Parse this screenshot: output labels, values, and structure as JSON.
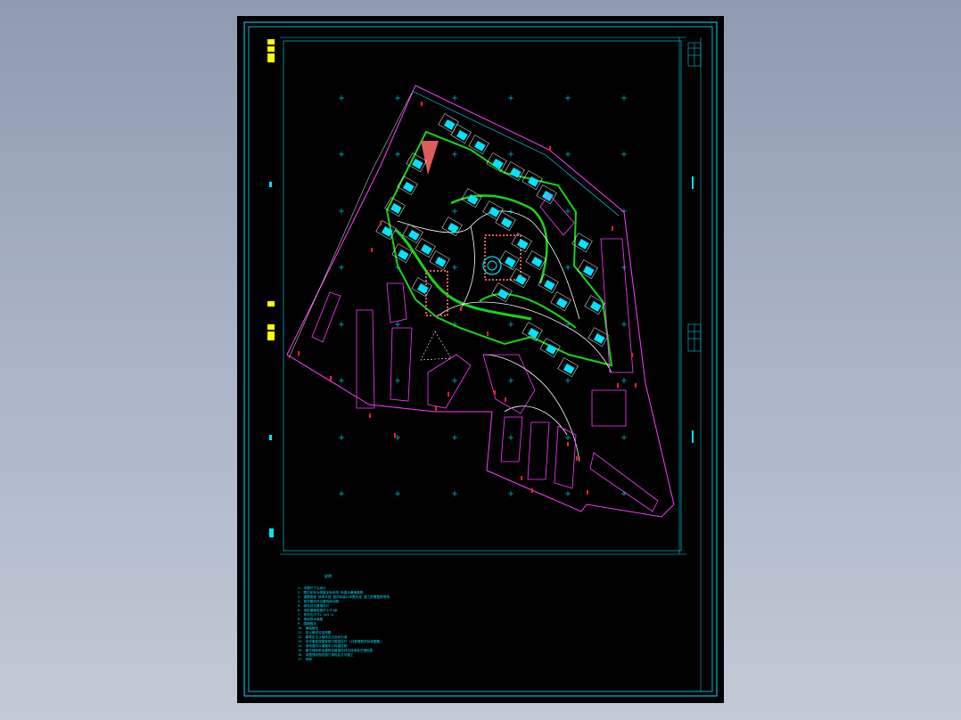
{
  "viewer": {
    "background_top": "#8e9bb0",
    "background_bottom": "#c3cad6",
    "sheet_color": "#000000"
  },
  "drawing": {
    "type": "CAD site plan",
    "colors": {
      "frame": "#00e5ff",
      "grid_cross": "#00e5ff",
      "boundary": "#ff3cff",
      "road": "#ffffff",
      "green": "#19d419",
      "yellow_text": "#ffff00",
      "plaza": "#e05c5c",
      "red_marks": "#ff2020"
    },
    "notes_title": "说明",
    "notes_lines": [
      "1. 本图尺寸以米计",
      "2. 图中坐标为测量坐标系统 标高为黄海高程",
      "3. 道路宽度 转弯半径 竖向标高以本图为准 施工前需复核现场",
      "4. 室外管线详见管线综合图",
      "5. 绿化详见景观设计",
      "6. 消防通道宽度不小于4米",
      "7. 停车位尺寸2.5x5.0",
      "8. 场地排水坡度",
      "9. 围墙做法",
      "10. 铺装做法",
      "11. 挡土墙详见结构图",
      "12. 建筑定位以轴线交点坐标为准",
      "13. 未尽事宜按国家现行规范执行 (并参照相关标准图集)",
      "14. 场地竖向以道路中心标高控制",
      "15. 图中绿地率及建筑密度指标详见技术经济指标表",
      "16. 本图须经规划部门审批后方可施工",
      "17. 其他"
    ]
  }
}
